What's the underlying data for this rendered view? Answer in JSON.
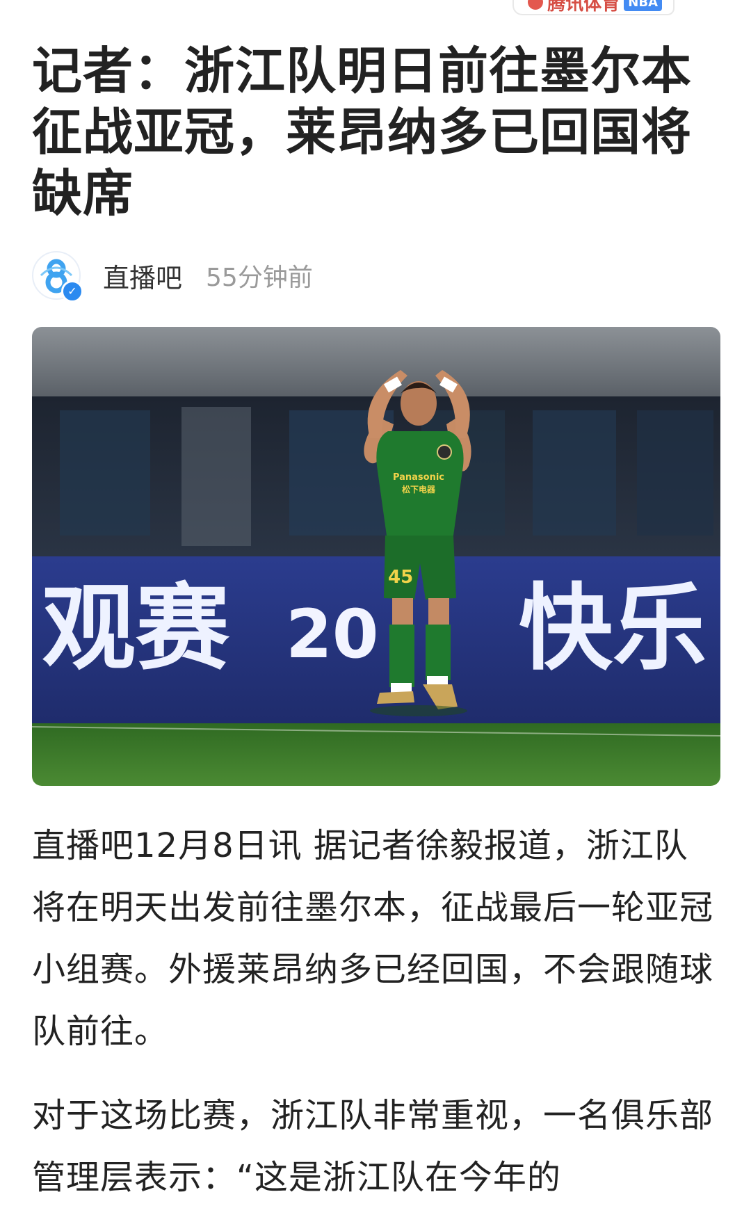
{
  "watermark": {
    "source_label": "腾讯体育",
    "badge": "NBA"
  },
  "article": {
    "title": "记者：浙江队明日前往墨尔本征战亚冠，莱昂纳多已回国将缺席",
    "author": {
      "name": "直播吧",
      "avatar_icon": "zhibo8-logo-icon",
      "verified": true,
      "verified_icon": "verified-check-icon"
    },
    "publish_time": "55分钟前",
    "hero_image": {
      "billboard_left": "观赛",
      "billboard_center": "20",
      "billboard_right": "快乐",
      "shirt_sponsor_en": "Panasonic",
      "shirt_sponsor_cn": "松下电器",
      "shorts_number": "45"
    },
    "paragraphs": [
      "直播吧12月8日讯 据记者徐毅报道，浙江队将在明天出发前往墨尔本，征战最后一轮亚冠小组赛。外援莱昂纳多已经回国，不会跟随球队前往。",
      "对于这场比赛，浙江队非常重视，一名俱乐部管理层表示：“这是浙江队在今年的"
    ]
  },
  "colors": {
    "title_text": "#222222",
    "muted_text": "#9a9a9a",
    "pitch_green": "#3f7a2c",
    "jersey_green": "#1f7a2e",
    "billboard_blue": "#283a86"
  }
}
